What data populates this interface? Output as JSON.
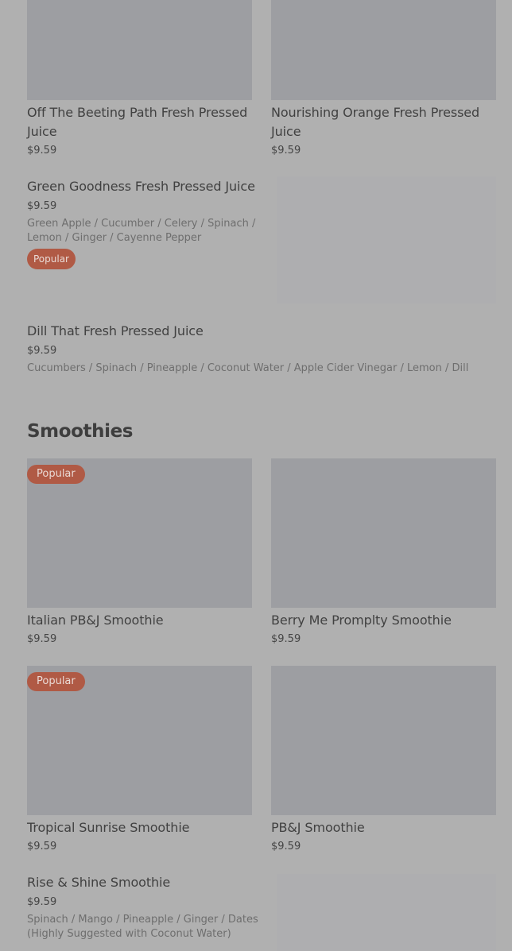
{
  "juices": {
    "items": [
      {
        "title": "Off The Beeting Path Fresh Pressed Juice",
        "price": "$9.59"
      },
      {
        "title": "Nourishing Orange Fresh Pressed Juice",
        "price": "$9.59"
      },
      {
        "title": "Green Goodness Fresh Pressed Juice",
        "price": "$9.59",
        "desc": "Green Apple / Cucumber / Celery / Spinach / Lemon / Ginger / Cayenne Pepper",
        "badge": "Popular"
      },
      {
        "title": "Dill That Fresh Pressed Juice",
        "price": "$9.59",
        "desc": "Cucumbers / Spinach / Pineapple / Coconut Water / Apple Cider Vinegar / Lemon / Dill"
      }
    ]
  },
  "smoothies": {
    "heading": "Smoothies",
    "items": [
      {
        "title": "Italian PB&J Smoothie",
        "price": "$9.59",
        "badge": "Popular"
      },
      {
        "title": "Berry Me Promplty Smoothie",
        "price": "$9.59"
      },
      {
        "title": "Tropical Sunrise Smoothie",
        "price": "$9.59",
        "badge": "Popular"
      },
      {
        "title": "PB&J Smoothie",
        "price": "$9.59"
      },
      {
        "title": "Rise & Shine Smoothie",
        "price": "$9.59",
        "desc": "Spinach / Mango / Pineapple / Ginger / Dates (Highly Suggested with Coconut Water)"
      }
    ]
  },
  "colors": {
    "background": "#b0b0b0",
    "image_placeholder": "#9d9ea2",
    "badge": "#b05a45"
  }
}
